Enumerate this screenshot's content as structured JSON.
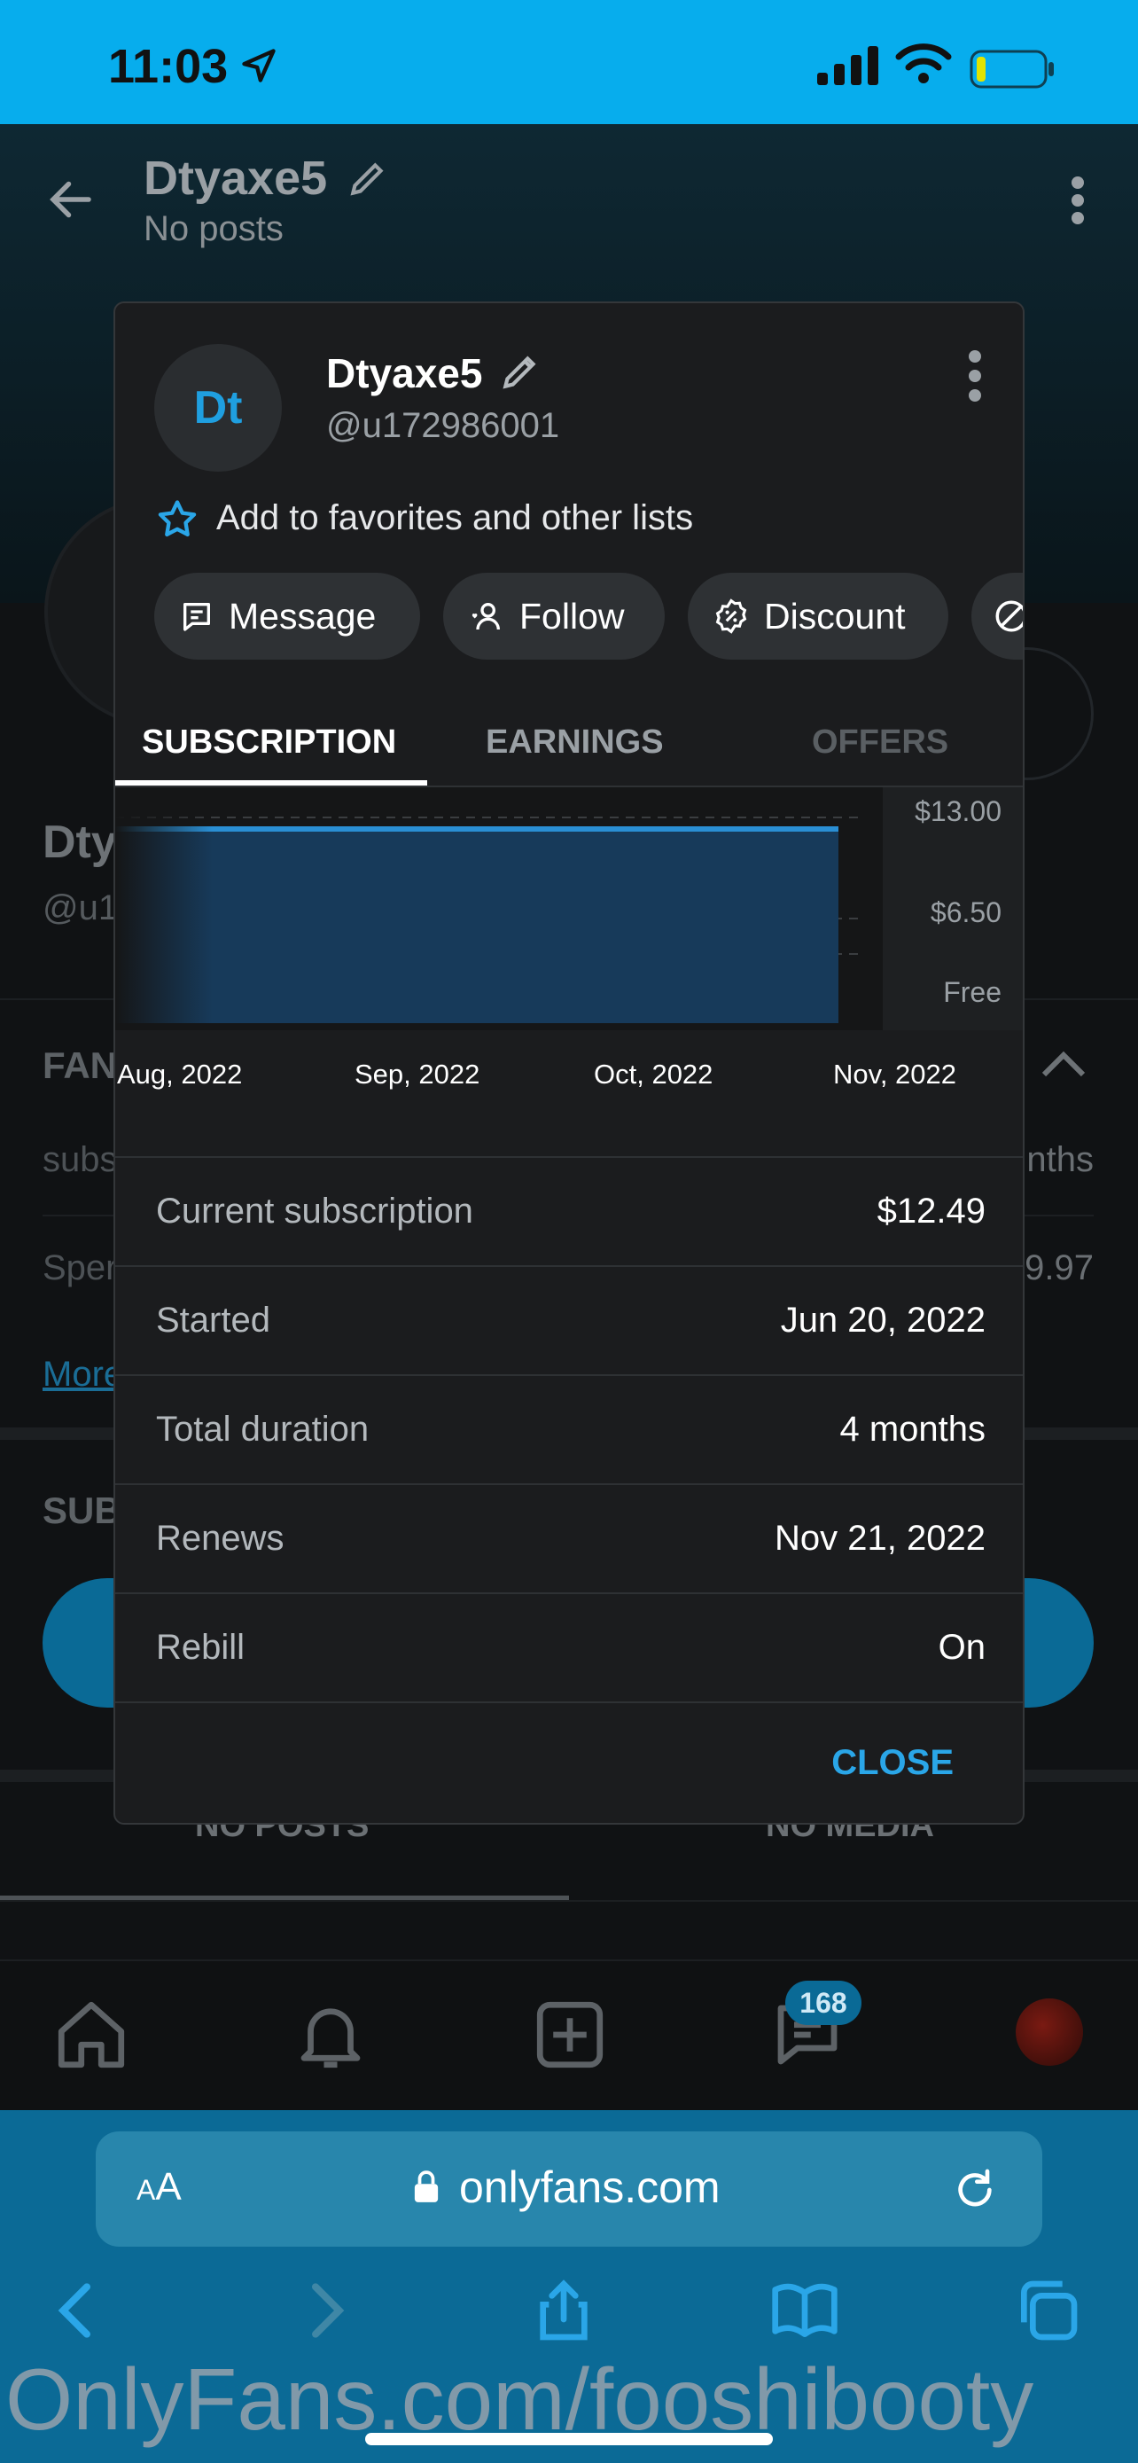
{
  "status_bar": {
    "time": "11:03"
  },
  "background": {
    "title": "Dtyaxe5",
    "subtitle": "No posts",
    "name_partial": "Dty",
    "handle_partial": "@u1",
    "fans_partial": "FAN",
    "row1_left": "subs",
    "row1_right": "nths",
    "row2_left": "Sper",
    "row2_right": "9.97",
    "more_partial": "More",
    "sub_partial": "SUB",
    "tab_posts": "NO POSTS",
    "tab_media": "NO MEDIA",
    "nav_badge": "168"
  },
  "modal": {
    "avatar_initials": "Dt",
    "name": "Dtyaxe5",
    "handle": "@u172986001",
    "favorites_label": "Add to favorites and other lists",
    "chips": {
      "message": "Message",
      "follow": "Follow",
      "discount": "Discount"
    },
    "tabs": {
      "subscription": "SUBSCRIPTION",
      "earnings": "EARNINGS",
      "offers": "OFFERS"
    },
    "details": {
      "current_label": "Current subscription",
      "current_value": "$12.49",
      "started_label": "Started",
      "started_value": "Jun 20, 2022",
      "duration_label": "Total duration",
      "duration_value": "4 months",
      "renews_label": "Renews",
      "renews_value": "Nov 21, 2022",
      "rebill_label": "Rebill",
      "rebill_value": "On"
    },
    "close_label": "CLOSE"
  },
  "chart_data": {
    "type": "area",
    "x": [
      "Aug, 2022",
      "Sep, 2022",
      "Oct, 2022",
      "Nov, 2022"
    ],
    "series": [
      {
        "values": [
          12.49,
          12.49,
          12.49,
          12.49
        ]
      }
    ],
    "y_tick_labels": [
      "$13.00",
      "$6.50",
      "Free"
    ],
    "ylim": [
      0,
      13
    ],
    "grid": true,
    "color": "#2a8fd4"
  },
  "safari": {
    "url": "onlyfans.com",
    "aa_label": "AA"
  },
  "watermark": "OnlyFans.com/fooshibooty",
  "colors": {
    "accent": "#07aded",
    "link": "#2aa6e8",
    "modal_bg": "#1b1c1e"
  }
}
